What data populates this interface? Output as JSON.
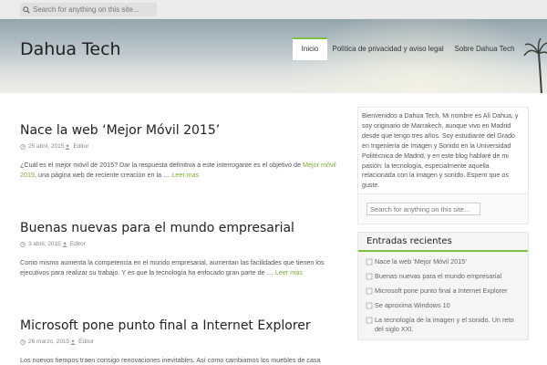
{
  "topbar": {
    "search_placeholder": "Search for anything on this site..."
  },
  "header": {
    "site_title": "Dahua Tech",
    "nav": [
      "Inicio",
      "Política de privacidad y aviso legal",
      "Sobre Dahua Tech"
    ]
  },
  "posts": [
    {
      "title": "Nace la web ‘Mejor Móvil 2015’",
      "date": "25 abril, 2015",
      "author": "Editor",
      "excerpt_start": "¿Cuál es el mejor móvil de 2015? Dar la respuesta definitiva a este interrogante es el objetivo de ",
      "excerpt_link": "Mejor móvil 2015",
      "excerpt_end": ", una página web de reciente creación en la … ",
      "read_more": "Leer mas"
    },
    {
      "title": "Buenas nuevas para el mundo empresarial",
      "date": "3 abril, 2015",
      "author": "Editor",
      "excerpt_start": "Como mismo aumenta la competencia en el mundo empresarial, aumentan las facilidades que tienen los ejecutivos para realizar su trabajo. Y es que la tecnología ha enfocado gran parte de … ",
      "excerpt_link": "",
      "excerpt_end": "",
      "read_more": "Leer mas"
    },
    {
      "title": "Microsoft pone punto final a Internet Explorer",
      "date": "26 marzo, 2015",
      "author": "Editor",
      "excerpt_start": "Los nuevos tiempos traen consigo renovaciones inevitables. Así como cambiamos los muebles de casa",
      "excerpt_link": "",
      "excerpt_end": "",
      "read_more": ""
    }
  ],
  "sidebar": {
    "intro": "Bienvenidos a Dahua Tech. Mi nombre es Alí Dahua, y soy originario de Marrakech, aunque vivo en Madrid desde que tengo tres años. Soy estudiante del Grado en Ingeniería de Imagen y Sonido en la Universidad Politécnica de Madrid, y en este blog hablaré de mi pasión: la tecnología, especialmente aquella relacionada con la imagen y sonido. Espero que os guste.",
    "search_placeholder": "Search for anything on this site...",
    "recent_title": "Entradas recientes",
    "recent_posts": [
      "Nace la web ‘Mejor Móvil 2015’",
      "Buenas nuevas para el mundo empresarial",
      "Microsoft pone punto final a Internet Explorer",
      "Se aproxima Windows 10",
      "La tecnología de la imagen y el sonido. Un reto del siglo XXI."
    ]
  },
  "colors": {
    "accent": "#7cc245",
    "link": "#7cab3a"
  },
  "icons": [
    "search-icon",
    "calendar-icon",
    "user-icon",
    "bullet-icon",
    "palm-tree-icon"
  ]
}
